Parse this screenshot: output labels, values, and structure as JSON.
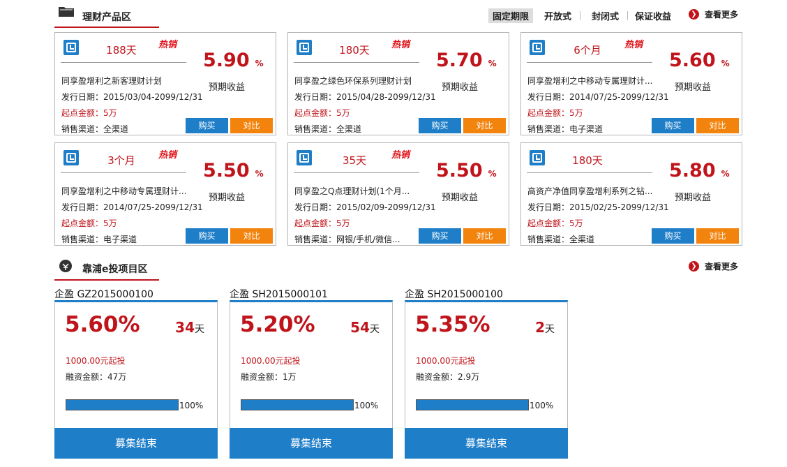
{
  "finance": {
    "title": "理财产品区",
    "tabs": [
      "固定期限",
      "开放式",
      "封闭式",
      "保证收益"
    ],
    "more": "查看更多",
    "expected_label": "预期收益",
    "buy_label": "购买",
    "compare_label": "对比",
    "hot_label": "热销",
    "cards": [
      {
        "term": "188天",
        "hot": true,
        "rate": "5.90",
        "pct": "%",
        "name": "同享盈增利之新客理财计划",
        "date": "发行日期：2015/03/04-2099/12/31",
        "min": "起点金额：5万",
        "channel": "销售渠道：全渠道"
      },
      {
        "term": "180天",
        "hot": true,
        "rate": "5.70",
        "pct": "%",
        "name": "同享盈之绿色环保系列理财计划",
        "date": "发行日期：2015/04/28-2099/12/31",
        "min": "起点金额：5万",
        "channel": "销售渠道：全渠道"
      },
      {
        "term": "6个月",
        "hot": true,
        "rate": "5.60",
        "pct": "%",
        "name": "同享盈增利之中移动专属理财计...",
        "date": "发行日期：2014/07/25-2099/12/31",
        "min": "起点金额：5万",
        "channel": "销售渠道：电子渠道"
      },
      {
        "term": "3个月",
        "hot": true,
        "rate": "5.50",
        "pct": "%",
        "name": "同享盈增利之中移动专属理财计...",
        "date": "发行日期：2014/07/25-2099/12/31",
        "min": "起点金额：5万",
        "channel": "销售渠道：电子渠道"
      },
      {
        "term": "35天",
        "hot": true,
        "rate": "5.50",
        "pct": "%",
        "name": "同享盈之Q点理财计划(1个月...",
        "date": "发行日期：2015/02/09-2099/12/31",
        "min": "起点金额：5万",
        "channel": "销售渠道：网银/手机/微信..."
      },
      {
        "term": "180天",
        "hot": false,
        "rate": "5.80",
        "pct": "%",
        "name": "高资产净值同享盈增利系列之钻...",
        "date": "发行日期：2015/02/25-2099/12/31",
        "min": "起点金额：5万",
        "channel": "销售渠道：全渠道"
      }
    ]
  },
  "einvest": {
    "title": "靠浦e投项目区",
    "more": "查看更多",
    "days_unit": "天",
    "end_label": "募集结束",
    "projects": [
      {
        "label": "企盈 GZ2015000100",
        "rate": "5.60%",
        "days": "34",
        "min": "1000.00元起投",
        "financing": "融资金额：47万",
        "progress": 100,
        "progress_text": "100%"
      },
      {
        "label": "企盈 SH2015000101",
        "rate": "5.20%",
        "days": "54",
        "min": "1000.00元起投",
        "financing": "融资金额：1万",
        "progress": 100,
        "progress_text": "100%"
      },
      {
        "label": "企盈 SH2015000100",
        "rate": "5.35%",
        "days": "2",
        "min": "1000.00元起投",
        "financing": "融资金额：2.9万",
        "progress": 100,
        "progress_text": "100%"
      }
    ]
  },
  "colors": {
    "brand_red": "#c0141b",
    "blue": "#1e7ec8",
    "orange": "#f2840e"
  },
  "icons": {
    "folder": "folder-icon",
    "einvest": "coin-icon",
    "more": "chevron-right-circle-icon",
    "clock": "clock-icon"
  }
}
